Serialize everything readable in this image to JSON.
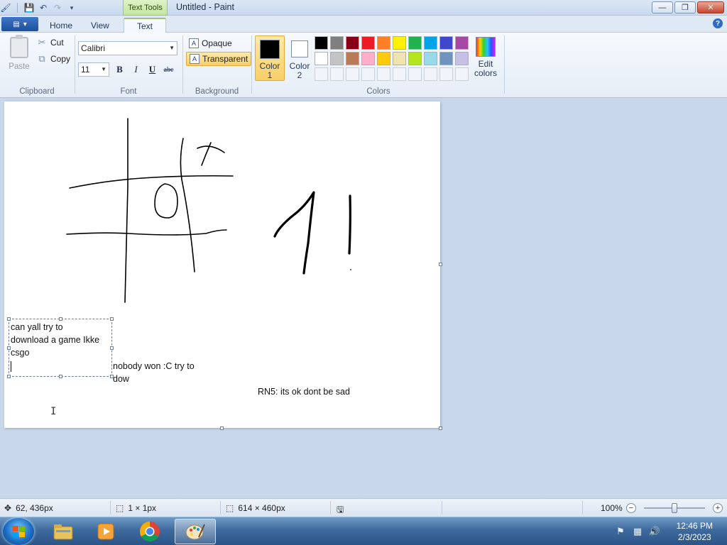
{
  "window": {
    "title": "Untitled - Paint",
    "context_tab": "Text Tools",
    "buttons": {
      "minimize": "—",
      "maximize": "❐",
      "close": "✕"
    }
  },
  "tabs": {
    "home": "Home",
    "view": "View",
    "text": "Text"
  },
  "clipboard": {
    "paste": "Paste",
    "cut": "Cut",
    "copy": "Copy",
    "label": "Clipboard"
  },
  "font": {
    "family": "Calibri",
    "size": "11",
    "bold": "B",
    "italic": "I",
    "underline": "U",
    "strike": "abc",
    "label": "Font"
  },
  "background": {
    "opaque": "Opaque",
    "transparent": "Transparent",
    "label": "Background"
  },
  "colors": {
    "color1_label": "Color 1",
    "color2_label": "Color 2",
    "color1": "#000000",
    "color2": "#ffffff",
    "edit_label": "Edit colors",
    "label": "Colors",
    "palette": [
      "#000000",
      "#7f7f7f",
      "#880015",
      "#ed1c24",
      "#ff7f27",
      "#fff200",
      "#22b14c",
      "#00a2e8",
      "#3f48cc",
      "#a349a4",
      "#ffffff",
      "#c3c3c3",
      "#b97a57",
      "#ffaec9",
      "#ffc90e",
      "#efe4b0",
      "#b5e61d",
      "#99d9ea",
      "#7092be",
      "#c8bfe7",
      "",
      "",
      "",
      "",
      "",
      "",
      "",
      "",
      "",
      ""
    ]
  },
  "canvas": {
    "textbox_lines": [
      "can yall try to",
      "download a game Ikke",
      "csgo"
    ],
    "text2_lines": [
      "nobody won :C try to",
      "dow"
    ],
    "text3": "RN5: its ok dont be sad"
  },
  "status": {
    "cursor_pos": "62, 436px",
    "selection_size": "1 × 1px",
    "image_size": "614 × 460px",
    "zoom": "100%",
    "zoom_level": 1.0
  },
  "taskbar": {
    "time": "12:46 PM",
    "date": "2/3/2023"
  }
}
